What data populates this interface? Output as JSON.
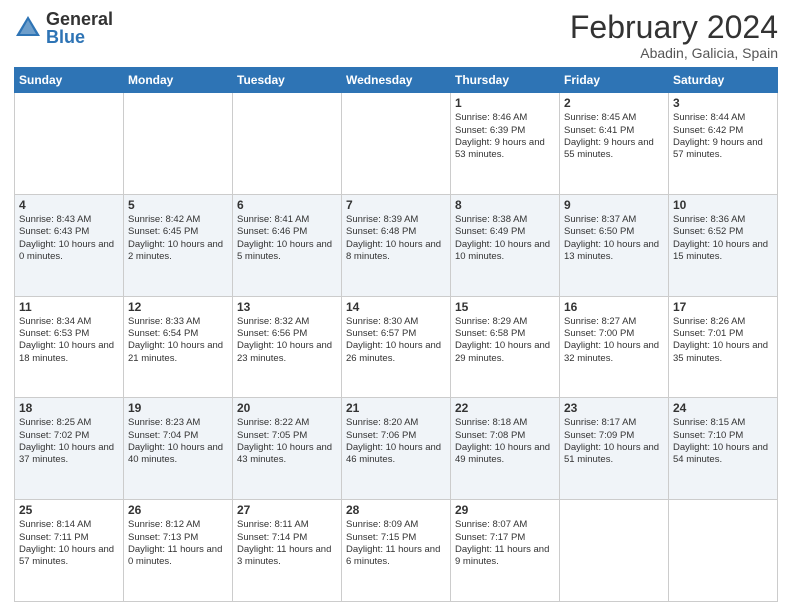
{
  "header": {
    "logo_general": "General",
    "logo_blue": "Blue",
    "month_year": "February 2024",
    "location": "Abadin, Galicia, Spain"
  },
  "days_of_week": [
    "Sunday",
    "Monday",
    "Tuesday",
    "Wednesday",
    "Thursday",
    "Friday",
    "Saturday"
  ],
  "weeks": [
    [
      {
        "day": "",
        "text": ""
      },
      {
        "day": "",
        "text": ""
      },
      {
        "day": "",
        "text": ""
      },
      {
        "day": "",
        "text": ""
      },
      {
        "day": "1",
        "text": "Sunrise: 8:46 AM\nSunset: 6:39 PM\nDaylight: 9 hours and 53 minutes."
      },
      {
        "day": "2",
        "text": "Sunrise: 8:45 AM\nSunset: 6:41 PM\nDaylight: 9 hours and 55 minutes."
      },
      {
        "day": "3",
        "text": "Sunrise: 8:44 AM\nSunset: 6:42 PM\nDaylight: 9 hours and 57 minutes."
      }
    ],
    [
      {
        "day": "4",
        "text": "Sunrise: 8:43 AM\nSunset: 6:43 PM\nDaylight: 10 hours and 0 minutes."
      },
      {
        "day": "5",
        "text": "Sunrise: 8:42 AM\nSunset: 6:45 PM\nDaylight: 10 hours and 2 minutes."
      },
      {
        "day": "6",
        "text": "Sunrise: 8:41 AM\nSunset: 6:46 PM\nDaylight: 10 hours and 5 minutes."
      },
      {
        "day": "7",
        "text": "Sunrise: 8:39 AM\nSunset: 6:48 PM\nDaylight: 10 hours and 8 minutes."
      },
      {
        "day": "8",
        "text": "Sunrise: 8:38 AM\nSunset: 6:49 PM\nDaylight: 10 hours and 10 minutes."
      },
      {
        "day": "9",
        "text": "Sunrise: 8:37 AM\nSunset: 6:50 PM\nDaylight: 10 hours and 13 minutes."
      },
      {
        "day": "10",
        "text": "Sunrise: 8:36 AM\nSunset: 6:52 PM\nDaylight: 10 hours and 15 minutes."
      }
    ],
    [
      {
        "day": "11",
        "text": "Sunrise: 8:34 AM\nSunset: 6:53 PM\nDaylight: 10 hours and 18 minutes."
      },
      {
        "day": "12",
        "text": "Sunrise: 8:33 AM\nSunset: 6:54 PM\nDaylight: 10 hours and 21 minutes."
      },
      {
        "day": "13",
        "text": "Sunrise: 8:32 AM\nSunset: 6:56 PM\nDaylight: 10 hours and 23 minutes."
      },
      {
        "day": "14",
        "text": "Sunrise: 8:30 AM\nSunset: 6:57 PM\nDaylight: 10 hours and 26 minutes."
      },
      {
        "day": "15",
        "text": "Sunrise: 8:29 AM\nSunset: 6:58 PM\nDaylight: 10 hours and 29 minutes."
      },
      {
        "day": "16",
        "text": "Sunrise: 8:27 AM\nSunset: 7:00 PM\nDaylight: 10 hours and 32 minutes."
      },
      {
        "day": "17",
        "text": "Sunrise: 8:26 AM\nSunset: 7:01 PM\nDaylight: 10 hours and 35 minutes."
      }
    ],
    [
      {
        "day": "18",
        "text": "Sunrise: 8:25 AM\nSunset: 7:02 PM\nDaylight: 10 hours and 37 minutes."
      },
      {
        "day": "19",
        "text": "Sunrise: 8:23 AM\nSunset: 7:04 PM\nDaylight: 10 hours and 40 minutes."
      },
      {
        "day": "20",
        "text": "Sunrise: 8:22 AM\nSunset: 7:05 PM\nDaylight: 10 hours and 43 minutes."
      },
      {
        "day": "21",
        "text": "Sunrise: 8:20 AM\nSunset: 7:06 PM\nDaylight: 10 hours and 46 minutes."
      },
      {
        "day": "22",
        "text": "Sunrise: 8:18 AM\nSunset: 7:08 PM\nDaylight: 10 hours and 49 minutes."
      },
      {
        "day": "23",
        "text": "Sunrise: 8:17 AM\nSunset: 7:09 PM\nDaylight: 10 hours and 51 minutes."
      },
      {
        "day": "24",
        "text": "Sunrise: 8:15 AM\nSunset: 7:10 PM\nDaylight: 10 hours and 54 minutes."
      }
    ],
    [
      {
        "day": "25",
        "text": "Sunrise: 8:14 AM\nSunset: 7:11 PM\nDaylight: 10 hours and 57 minutes."
      },
      {
        "day": "26",
        "text": "Sunrise: 8:12 AM\nSunset: 7:13 PM\nDaylight: 11 hours and 0 minutes."
      },
      {
        "day": "27",
        "text": "Sunrise: 8:11 AM\nSunset: 7:14 PM\nDaylight: 11 hours and 3 minutes."
      },
      {
        "day": "28",
        "text": "Sunrise: 8:09 AM\nSunset: 7:15 PM\nDaylight: 11 hours and 6 minutes."
      },
      {
        "day": "29",
        "text": "Sunrise: 8:07 AM\nSunset: 7:17 PM\nDaylight: 11 hours and 9 minutes."
      },
      {
        "day": "",
        "text": ""
      },
      {
        "day": "",
        "text": ""
      }
    ]
  ]
}
